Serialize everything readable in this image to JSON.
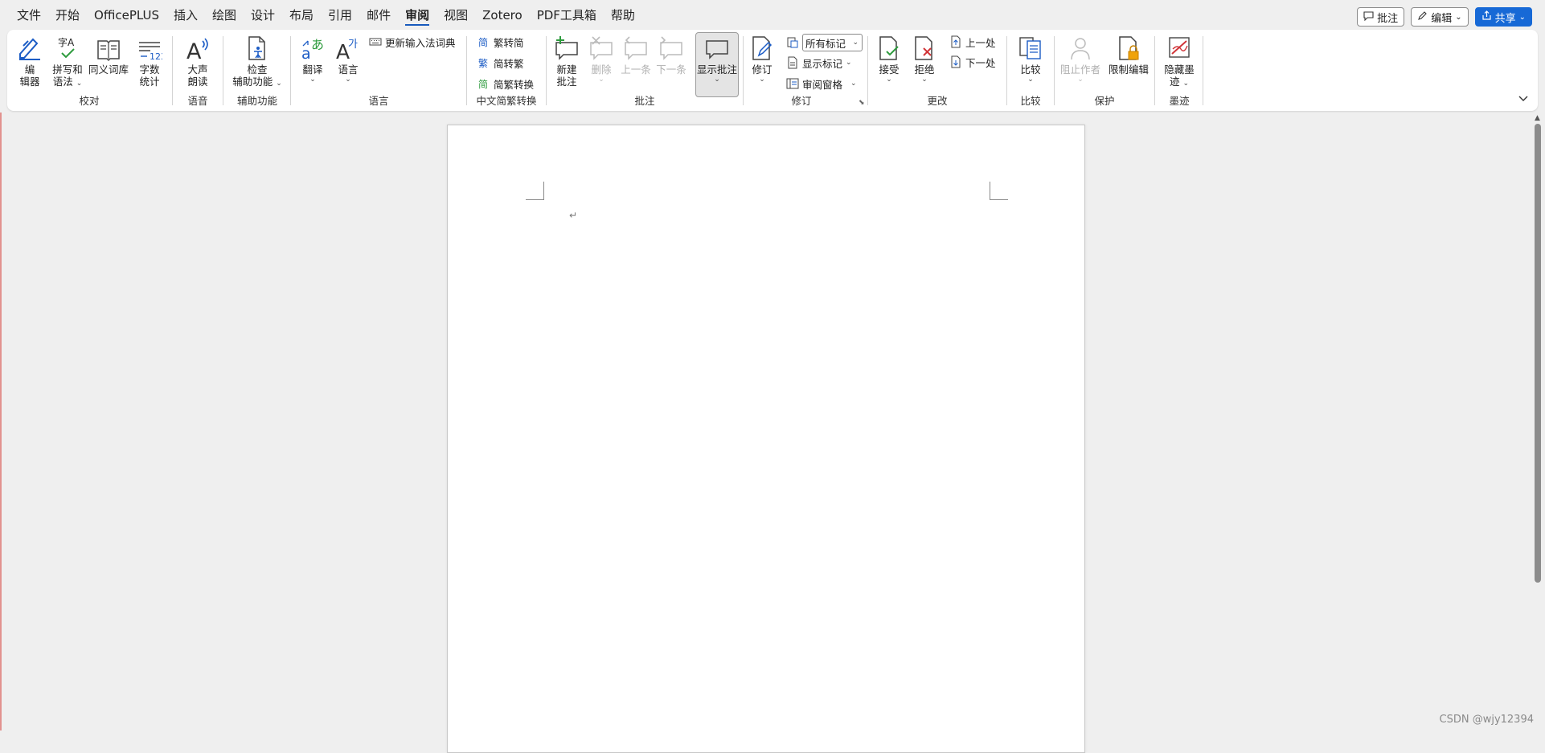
{
  "menu": {
    "tabs": [
      "文件",
      "开始",
      "OfficePLUS",
      "插入",
      "绘图",
      "设计",
      "布局",
      "引用",
      "邮件",
      "审阅",
      "视图",
      "Zotero",
      "PDF工具箱",
      "帮助"
    ],
    "active_tab": "审阅"
  },
  "header_actions": {
    "comments": "批注",
    "editing": "编辑",
    "share": "共享"
  },
  "ribbon": {
    "proofing": {
      "label": "校对",
      "editor": "编辑器",
      "editor_l1": "编",
      "editor_l2": "辑器",
      "spelling": "拼写和语法",
      "spelling_l1": "拼写和",
      "spelling_l2": "语法",
      "thesaurus": "同义词库",
      "wordcount_l1": "字数",
      "wordcount_l2": "统计"
    },
    "speech": {
      "label": "语音",
      "read_aloud_l1": "大声",
      "read_aloud_l2": "朗读"
    },
    "accessibility": {
      "label": "辅助功能",
      "check_l1": "检查",
      "check_l2": "辅助功能"
    },
    "language": {
      "label": "语言",
      "translate": "翻译",
      "language": "语言",
      "update_ime": "更新输入法词典"
    },
    "chinese_conversion": {
      "label": "中文简繁转换",
      "trad_to_simp": "繁转简",
      "simp_to_trad": "简转繁",
      "convert": "简繁转换"
    },
    "comments": {
      "label": "批注",
      "new_l1": "新建",
      "new_l2": "批注",
      "delete": "删除",
      "previous": "上一条",
      "next": "下一条",
      "show": "显示批注"
    },
    "tracking": {
      "label": "修订",
      "track": "修订",
      "markup_select": "所有标记",
      "show_markup": "显示标记",
      "reviewing_pane": "审阅窗格"
    },
    "changes": {
      "label": "更改",
      "accept": "接受",
      "reject": "拒绝",
      "previous": "上一处",
      "next": "下一处"
    },
    "compare": {
      "label": "比较",
      "compare": "比较"
    },
    "protect": {
      "label": "保护",
      "block_authors": "阻止作者",
      "restrict_editing": "限制编辑"
    },
    "ink": {
      "label": "墨迹",
      "hide_ink_l1": "隐藏墨",
      "hide_ink_l2": "迹"
    }
  },
  "document": {
    "paragraph_mark": "↵"
  },
  "watermark": "CSDN @wjy12394",
  "colors": {
    "accent": "#185abd",
    "share_button": "#1769d6",
    "ribbon_bg": "#ffffff",
    "app_bg": "#efefef"
  }
}
